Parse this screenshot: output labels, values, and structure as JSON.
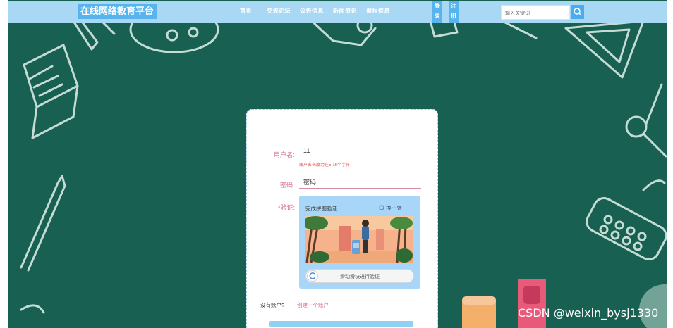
{
  "header": {
    "brand": "在线网络教育平台",
    "nav": [
      "首页",
      "交流论坛",
      "公告信息",
      "新闻资讯",
      "课程信息"
    ],
    "login_label": "登录",
    "register_label": "注册",
    "search_placeholder": "输入关键词",
    "search_icon": "search-icon"
  },
  "login_form": {
    "username_label": "用户名:",
    "username_value": "11",
    "username_hint": "账户名长度为在5-16个字符",
    "password_label": "密码:",
    "password_value": "密码",
    "captcha_required_mark": "*",
    "captcha_label": "验证:",
    "captcha_title": "完成拼图验证",
    "captcha_refresh": "换一张",
    "captcha_slider_text": "滑动滑块进行验证",
    "no_account_text": "没有账户?",
    "create_account_link": "创建一个账户"
  },
  "watermark": "CSDN @weixin_bysj1330",
  "colors": {
    "chalkboard": "#176052",
    "header_bg": "#a8d8f4",
    "accent_blue": "#58b4ee",
    "label_pink": "#d86a8a"
  }
}
